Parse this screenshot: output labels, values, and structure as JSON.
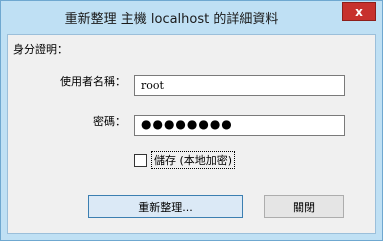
{
  "window": {
    "title": "重新整理 主機 localhost 的詳細資料",
    "close_glyph": "x"
  },
  "credentials": {
    "group_label": "身分證明：",
    "username_label": "使用者名稱：",
    "username_value": "root",
    "password_label": "密碼：",
    "password_masked": "●●●●●●●●",
    "save_checkbox_label": "儲存 (本地加密)",
    "save_checked": false
  },
  "buttons": {
    "refresh_label": "重新整理...",
    "close_label": "關閉"
  }
}
